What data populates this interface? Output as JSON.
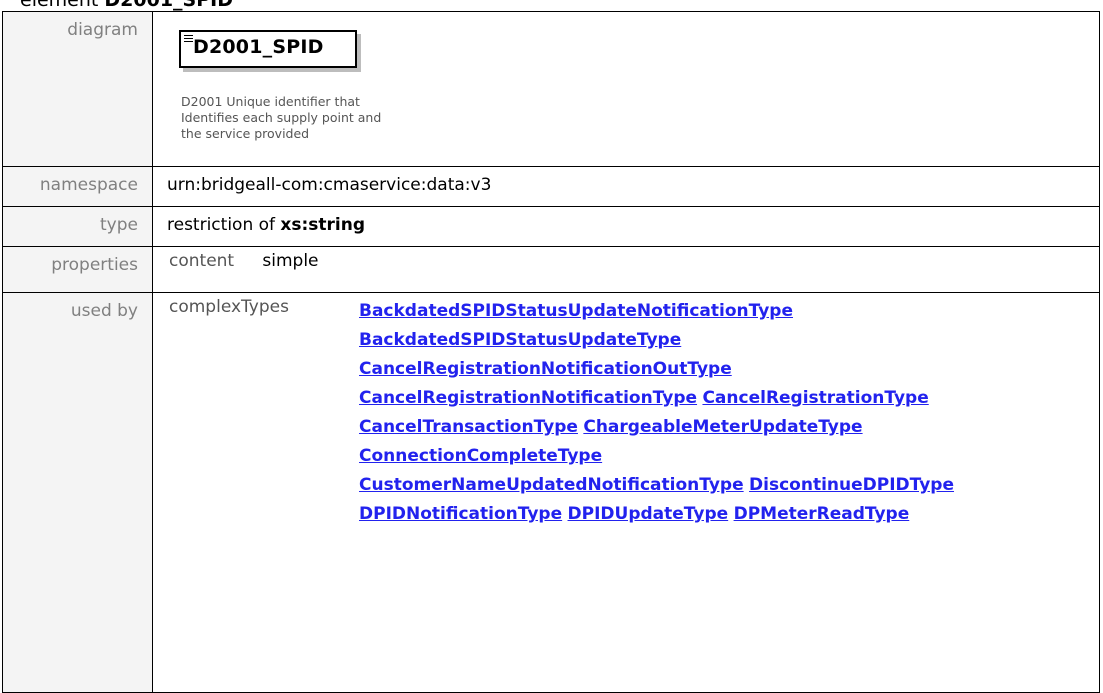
{
  "heading": {
    "prefix": "element",
    "name": "D2001_SPID"
  },
  "labels": {
    "diagram": "diagram",
    "namespace": "namespace",
    "type": "type",
    "properties": "properties",
    "used_by": "used by"
  },
  "diagram": {
    "title": "D2001_SPID",
    "description": "D2001 Unique identifier that Identifies each supply point and the service provided"
  },
  "namespace": "urn:bridgeall-com:cmaservice:data:v3",
  "type": {
    "prefix": "restriction of",
    "base": "xs:string"
  },
  "properties": {
    "key": "content",
    "value": "simple"
  },
  "used_by": {
    "key": "complexTypes",
    "links": [
      "BackdatedSPIDStatusUpdateNotificationType",
      "BackdatedSPIDStatusUpdateType",
      "CancelRegistrationNotificationOutType",
      "CancelRegistrationNotificationType",
      "CancelRegistrationType",
      "CancelTransactionType",
      "ChargeableMeterUpdateType",
      "ConnectionCompleteType",
      "CustomerNameUpdatedNotificationType",
      "DiscontinueDPIDType",
      "DPIDNotificationType",
      "DPIDUpdateType",
      "DPMeterReadType"
    ]
  }
}
